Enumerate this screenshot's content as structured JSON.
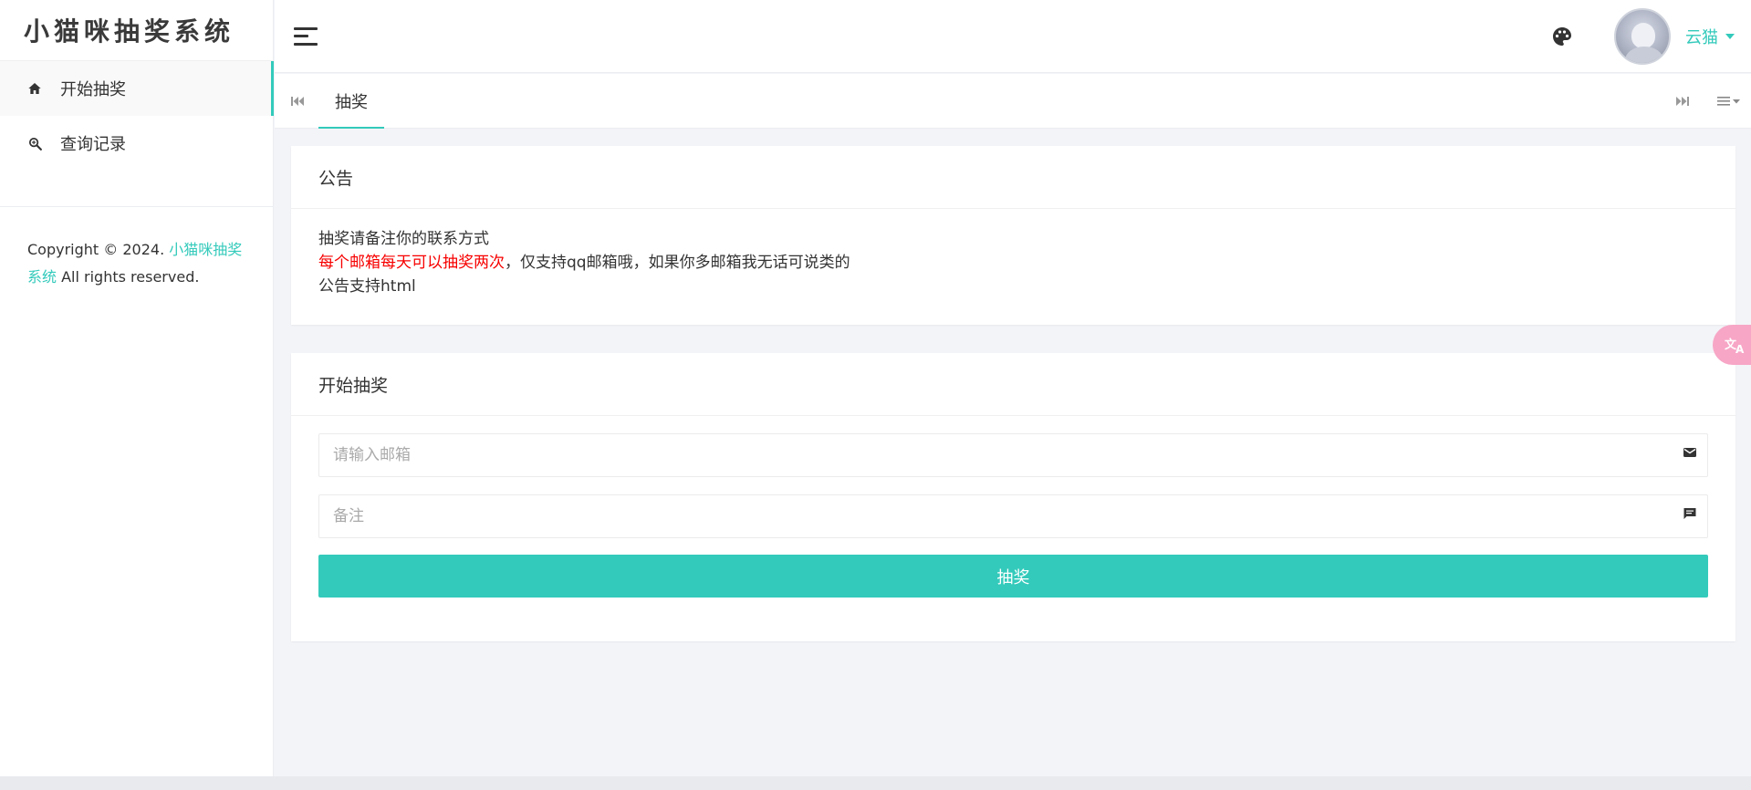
{
  "app": {
    "logo_text": "小猫咪抽奖系统"
  },
  "sidebar": {
    "items": [
      {
        "label": "开始抽奖",
        "icon": "home-icon",
        "active": true
      },
      {
        "label": "查询记录",
        "icon": "search-record-icon",
        "active": false
      }
    ],
    "copyright_prefix": "Copyright © 2024.",
    "copyright_link": "小猫咪抽奖系统",
    "copyright_suffix": "All rights reserved."
  },
  "header": {
    "username": "云猫",
    "palette_icon": "palette-icon",
    "menu_icon": "hamburger-icon"
  },
  "tabs": {
    "prev_icon": "skip-backward-icon",
    "next_icon": "skip-forward-icon",
    "menu_icon": "tab-menu-icon",
    "items": [
      {
        "label": "抽奖",
        "active": true
      }
    ]
  },
  "notice": {
    "title": "公告",
    "line1": "抽奖请备注你的联系方式",
    "line2_red": "每个邮箱每天可以抽奖两次",
    "line2_rest": "，仅支持qq邮箱哦，如果你多邮箱我无话可说类的",
    "line3": "公告支持html"
  },
  "lottery": {
    "title": "开始抽奖",
    "email_placeholder": "请输入邮箱",
    "email_icon": "mail-icon",
    "note_placeholder": "备注",
    "note_icon": "comment-icon",
    "submit_label": "抽奖"
  },
  "colors": {
    "accent": "#33cabb",
    "notice_red": "#f70000",
    "translate_bubble": "#f7a6c6"
  },
  "translate_widget": {
    "icon": "translate-icon"
  }
}
